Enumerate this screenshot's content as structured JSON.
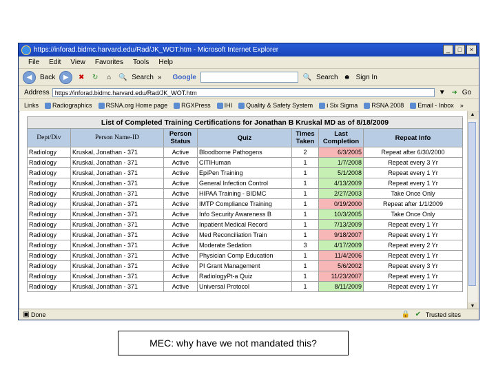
{
  "window": {
    "title": "https://inforad.bidmc.harvard.edu/Rad/JK_WOT.htm - Microsoft Internet Explorer",
    "buttons": [
      "_",
      "□",
      "×"
    ]
  },
  "menu": [
    "File",
    "Edit",
    "View",
    "Favorites",
    "Tools",
    "Help"
  ],
  "toolbar": {
    "back_label": "Back",
    "search_label": "Search",
    "chevron": "»",
    "google_label": "Google",
    "google_search_label": "Search",
    "signin_label": "Sign In"
  },
  "address": {
    "label": "Address",
    "value": "https://inforad.bidmc.harvard.edu/Rad/JK_WOT.htm",
    "go_label": "Go"
  },
  "links": {
    "label": "Links",
    "items": [
      "Radiographics",
      "RSNA.org Home page",
      "RGXPress",
      "IHI",
      "Quality & Safety System",
      "i Six Sigma",
      "RSNA 2008",
      "Email - Inbox"
    ],
    "chevron": "»"
  },
  "table": {
    "caption": "List of Completed Training Certifications for Jonathan B Kruskal MD as of 8/18/2009",
    "headers": [
      "Dept/Div",
      "Person Name-ID",
      "Person Status",
      "Quiz",
      "Times Taken",
      "Last Completion",
      "Repeat Info"
    ],
    "rows": [
      {
        "dept": "Radiology",
        "name": "Kruskal, Jonathan - 371",
        "status": "Active",
        "quiz": "Bloodborne Pathogens",
        "times": "2",
        "last": "6/3/2005",
        "last_status": "red",
        "repeat": "Repeat after 6/30/2000"
      },
      {
        "dept": "Radiology",
        "name": "Kruskal, Jonathan - 371",
        "status": "Active",
        "quiz": "CITIHuman",
        "times": "1",
        "last": "1/7/2008",
        "last_status": "green",
        "repeat": "Repeat every 3 Yr"
      },
      {
        "dept": "Radiology",
        "name": "Kruskal, Jonathan - 371",
        "status": "Active",
        "quiz": "EpiPen Training",
        "times": "1",
        "last": "5/1/2008",
        "last_status": "green",
        "repeat": "Repeat every 1 Yr"
      },
      {
        "dept": "Radiology",
        "name": "Kruskal, Jonathan - 371",
        "status": "Active",
        "quiz": "General Infection Control",
        "times": "1",
        "last": "4/13/2009",
        "last_status": "green",
        "repeat": "Repeat every 1 Yr"
      },
      {
        "dept": "Radiology",
        "name": "Kruskal, Jonathan - 371",
        "status": "Active",
        "quiz": "HIPAA Training - BIDMC",
        "times": "1",
        "last": "2/27/2003",
        "last_status": "green",
        "repeat": "Take Once Only"
      },
      {
        "dept": "Radiology",
        "name": "Kruskal, Jonathan - 371",
        "status": "Active",
        "quiz": "IMTP Compliance Training",
        "times": "1",
        "last": "0/19/2000",
        "last_status": "red",
        "repeat": "Repeat after 1/1/2009"
      },
      {
        "dept": "Radiology",
        "name": "Kruskal, Jonathan - 371",
        "status": "Active",
        "quiz": "Info Security Awareness B",
        "times": "1",
        "last": "10/3/2005",
        "last_status": "green",
        "repeat": "Take Once Only"
      },
      {
        "dept": "Radiology",
        "name": "Kruskal, Jonathan - 371",
        "status": "Active",
        "quiz": "Inpatient Medical Record",
        "times": "1",
        "last": "7/13/2009",
        "last_status": "green",
        "repeat": "Repeat every 1 Yr"
      },
      {
        "dept": "Radiology",
        "name": "Kruskal, Jonathan - 371",
        "status": "Active",
        "quiz": "Med Reconciliation Train",
        "times": "1",
        "last": "9/18/2007",
        "last_status": "red",
        "repeat": "Repeat every 1 Yr"
      },
      {
        "dept": "Radiology",
        "name": "Kruskal, Jonathan - 371",
        "status": "Active",
        "quiz": "Moderate Sedation",
        "times": "3",
        "last": "4/17/2009",
        "last_status": "green",
        "repeat": "Repeat every 2 Yr"
      },
      {
        "dept": "Radiology",
        "name": "Kruskal, Jonathan - 371",
        "status": "Active",
        "quiz": "Physician Comp Education",
        "times": "1",
        "last": "11/4/2006",
        "last_status": "red",
        "repeat": "Repeat every 1 Yr"
      },
      {
        "dept": "Radiology",
        "name": "Kruskal, Jonathan - 371",
        "status": "Active",
        "quiz": "PI Grant Management",
        "times": "1",
        "last": "5/6/2002",
        "last_status": "red",
        "repeat": "Repeat every 3 Yr"
      },
      {
        "dept": "Radiology",
        "name": "Kruskal, Jonathan - 371",
        "status": "Active",
        "quiz": "RadiologyPt-a Quiz",
        "times": "1",
        "last": "11/23/2007",
        "last_status": "red",
        "repeat": "Repeat every 1 Yr"
      },
      {
        "dept": "Radiology",
        "name": "Kruskal, Jonathan - 371",
        "status": "Active",
        "quiz": "Universal Protocol",
        "times": "1",
        "last": "8/11/2009",
        "last_status": "green",
        "repeat": "Repeat every 1 Yr"
      }
    ]
  },
  "status": {
    "left": "Done",
    "zone": "Trusted sites"
  },
  "note": "MEC: why have we not mandated this?"
}
